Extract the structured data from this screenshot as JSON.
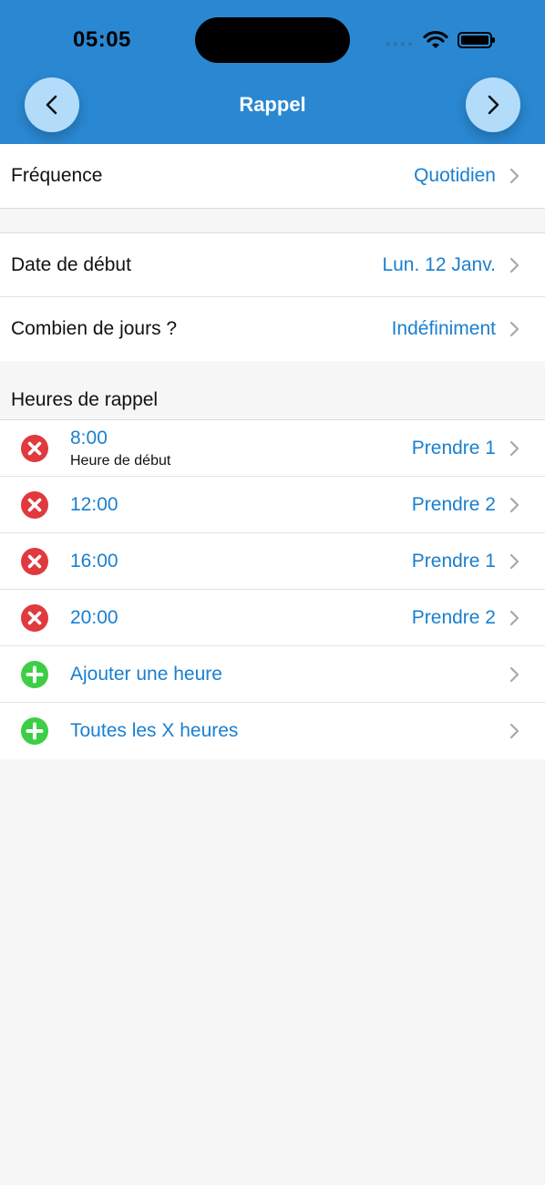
{
  "status_bar": {
    "time": "05:05"
  },
  "header": {
    "title": "Rappel",
    "back_icon": "chevron-left-icon",
    "forward_icon": "chevron-right-icon",
    "color": "#2a88d2"
  },
  "frequency": {
    "label": "Fréquence",
    "value": "Quotidien"
  },
  "schedule": {
    "start_date": {
      "label": "Date de début",
      "value": "Lun. 12 Janv."
    },
    "duration": {
      "label": "Combien de jours ?",
      "value": "Indéfiniment"
    }
  },
  "reminder_times": {
    "header": "Heures de rappel",
    "items": [
      {
        "time": "8:00",
        "subtitle": "Heure de début",
        "dose": "Prendre 1"
      },
      {
        "time": "12:00",
        "dose": "Prendre 2"
      },
      {
        "time": "16:00",
        "dose": "Prendre 1"
      },
      {
        "time": "20:00",
        "dose": "Prendre 2"
      }
    ],
    "add_time": "Ajouter une heure",
    "every_x_hours": "Toutes les X heures"
  },
  "colors": {
    "accent": "#1a7fcf",
    "delete": "#e0393e",
    "add": "#3ccf45"
  }
}
